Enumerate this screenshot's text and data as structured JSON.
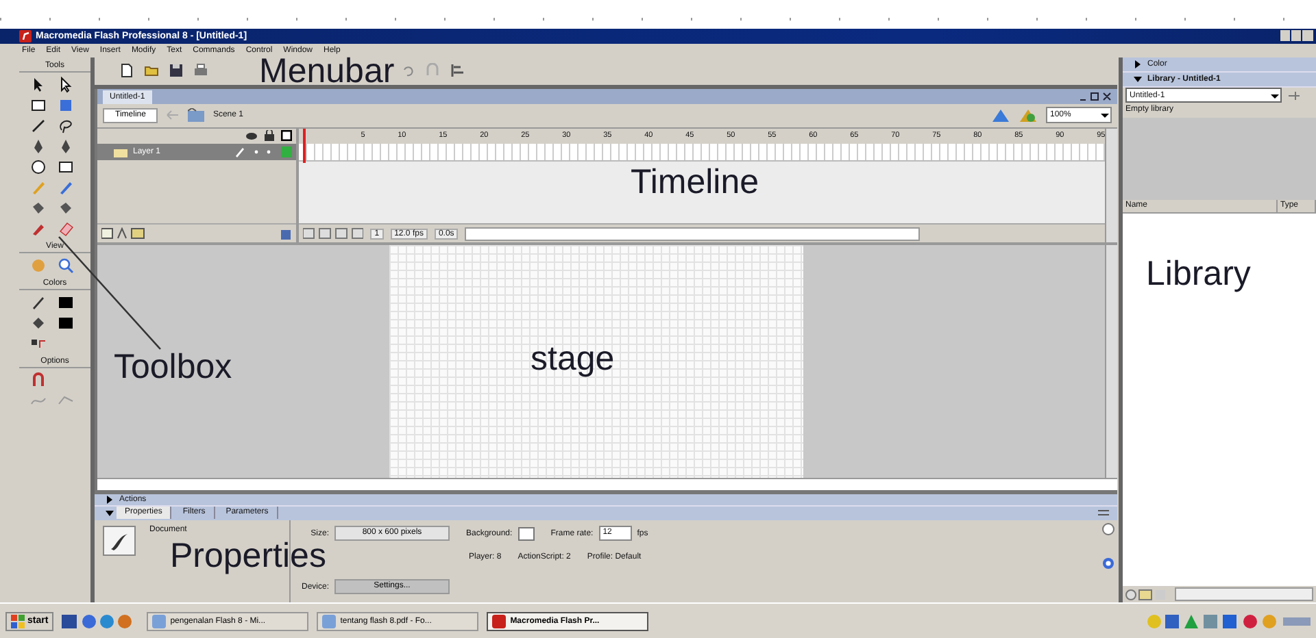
{
  "window": {
    "title": "Macromedia Flash Professional 8 - [Untitled-1]"
  },
  "menu": [
    "File",
    "Edit",
    "View",
    "Insert",
    "Modify",
    "Text",
    "Commands",
    "Control",
    "Window",
    "Help"
  ],
  "toolbox": {
    "title": "Tools",
    "sections": [
      "View",
      "Colors",
      "Options"
    ]
  },
  "document": {
    "tab": "Untitled-1",
    "timeline_button": "Timeline",
    "scene": "Scene 1",
    "zoom": "100%",
    "frame_numbers": [
      "5",
      "10",
      "15",
      "20",
      "25",
      "30",
      "35",
      "40",
      "45",
      "50",
      "55",
      "60",
      "65",
      "70",
      "75",
      "80",
      "85",
      "90",
      "95"
    ],
    "layers": [
      {
        "name": "Layer 1",
        "selected": true
      }
    ],
    "current_frame": "1",
    "frame_rate": "12.0 fps",
    "elapsed": "0.0s"
  },
  "properties": {
    "collapsed_panel": "Actions",
    "tabs": [
      {
        "label": "Properties",
        "selected": true
      },
      {
        "label": "Filters",
        "selected": false
      },
      {
        "label": "Parameters",
        "selected": false
      }
    ],
    "document_label": "Document",
    "size_label": "Size:",
    "size_value": "800 x 600 pixels",
    "background_label": "Background:",
    "frame_rate_label": "Frame rate:",
    "frame_rate_value": "12",
    "fps": "fps",
    "player": "Player: 8",
    "actionscript": "ActionScript: 2",
    "profile": "Profile: Default",
    "device_label": "Device:",
    "device_button": "Settings..."
  },
  "library": {
    "collapsed_panel": "Color",
    "title": "Library - Untitled-1",
    "document": "Untitled-1",
    "status": "Empty library",
    "columns": [
      "Name",
      "Type"
    ]
  },
  "taskbar": {
    "start": "start",
    "tasks": [
      {
        "label": "pengenalan Flash 8 - Mi...",
        "selected": false
      },
      {
        "label": "tentang flash 8.pdf - Fo...",
        "selected": false
      },
      {
        "label": "Macromedia Flash Pr...",
        "selected": true
      }
    ]
  },
  "annotations": [
    {
      "kind": "menubar",
      "text": "Menubar"
    },
    {
      "kind": "timeline",
      "text": "Timeline"
    },
    {
      "kind": "toolbox",
      "text": "Toolbox"
    },
    {
      "kind": "stage",
      "text": "stage"
    },
    {
      "kind": "library",
      "text": "Library"
    },
    {
      "kind": "properties",
      "text": "Properties"
    }
  ]
}
